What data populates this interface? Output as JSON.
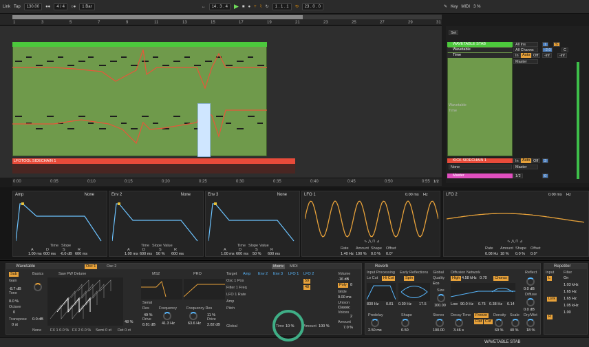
{
  "transport": {
    "link": "Link",
    "tap": "Tap",
    "tempo": "130.00",
    "signature": "4 / 4",
    "quantize": "1 Bar",
    "position": "14 . 3 . 4",
    "loop_start": "1 . 1 . 1",
    "loop_len": "23 . 0 . 0",
    "key": "Key",
    "midi": "MIDI",
    "cpu": "3 %"
  },
  "ruler": {
    "bars": [
      "1",
      "3",
      "5",
      "7",
      "9",
      "11",
      "13",
      "15",
      "17",
      "19",
      "21",
      "23",
      "25",
      "27",
      "29",
      "31"
    ]
  },
  "timeline": {
    "labels": [
      "0:00",
      "0:05",
      "0:10",
      "0:15",
      "0:20",
      "0:25",
      "0:30",
      "0:35",
      "0:40",
      "0:45",
      "0:50",
      "0:55"
    ],
    "zoom": "1/2"
  },
  "tracks": {
    "sidechain_clip": "LFOTOOL SIDECHAIN 1"
  },
  "mixer": {
    "set": "Set",
    "wavetable_track": "WAVETABLE STAB",
    "wavetable_device": "Wavetable",
    "time_param": "Time",
    "all_ins": "All Ins",
    "all_channels": "All Channs",
    "in": "In",
    "auto": "Auto",
    "off": "Off",
    "master": "Master",
    "value_neg2": "-2.0",
    "c": "C",
    "inf1": "-inf",
    "inf2": "-inf",
    "num1": "1",
    "num3": "3",
    "lane_wavetable": "Wavetable",
    "lane_time": "Time",
    "kick_track": "KICK SIDECHAIN 1",
    "none": "None",
    "master_track": "Master",
    "master_zoom": "1/2",
    "master_num": "0"
  },
  "mod_panels": {
    "amp": {
      "title": "Amp",
      "source": "None",
      "time": "Time",
      "slope": "Slope",
      "labels": [
        "A",
        "D",
        "S",
        "R"
      ],
      "values": [
        "1.00 ms",
        "600 ms",
        "-6.0 dB",
        "600 ms"
      ]
    },
    "env2": {
      "title": "Env 2",
      "source": "None",
      "time": "Time",
      "slope": "Slope",
      "value": "Value",
      "labels": [
        "A",
        "D",
        "S",
        "R"
      ],
      "values": [
        "1.00 ms",
        "600 ms",
        "50 %",
        "600 ms"
      ]
    },
    "env3": {
      "title": "Env 3",
      "source": "None",
      "time": "Time",
      "slope": "Slope",
      "value": "Value",
      "labels": [
        "A",
        "D",
        "S",
        "R"
      ],
      "values": [
        "1.00 ms",
        "600 ms",
        "50 %",
        "600 ms"
      ]
    },
    "lfo1": {
      "title": "LFO 1",
      "time": "0.00 ms",
      "hz": "Hz",
      "labels": [
        "Rate",
        "Amount",
        "Shape",
        "Offset"
      ],
      "values": [
        "1.40 Hz",
        "100 %",
        "0.0 %",
        "0.0°"
      ]
    },
    "lfo2": {
      "title": "LFO 2",
      "time": "0.00 ms",
      "hz": "Hz",
      "labels": [
        "Rate",
        "Amount",
        "Shape",
        "Offset"
      ],
      "values": [
        "0.08 Hz",
        "18 %",
        "0.0 %",
        "0.0°"
      ]
    }
  },
  "wavetable": {
    "title": "Wavetable",
    "osc1": "Osc 1",
    "osc2": "Osc 2",
    "sub": "Sub",
    "basics": "Basics",
    "preset": "Saw PW Detune",
    "gain": "Gain",
    "gain_val": "-8.7 dB",
    "tone": "Tone",
    "tone_val": "0.0 %",
    "octave": "Octave",
    "octave_val": "0",
    "transpose": "Transpose",
    "transpose_val": "0 st",
    "fx1": "FX 1  0.0 %",
    "fx2": "FX 2  0.0 %",
    "semi": "Semi  0 st",
    "det": "Det  0 ct",
    "pos": "48 %",
    "none": "None",
    "db0": "0.0 dB",
    "filter_type": "MS2",
    "pro": "PRO",
    "serial": "Serial",
    "res": "Res",
    "res_val": "49 %",
    "frequency": "Frequency",
    "frequency_val": "41.3 Hz",
    "frequency_res": "Frequency  Res",
    "freq2_val": "63.6 Hz",
    "res2_val": "11 %",
    "drive": "Drive",
    "drive_val": "8.81 dB",
    "drive2": "Drive",
    "drive2_val": "2.82 dB",
    "matrix": "Matrix",
    "midi": "MIDI",
    "target": "Target",
    "cols": [
      "Amp",
      "Env 2",
      "Env 3",
      "LFO 1",
      "LFO 2"
    ],
    "rows": [
      "Osc 1 Pos",
      "Filter 1 Freq",
      "LFO 1 Rate",
      "Amp",
      "Pitch"
    ],
    "cell1": "59",
    "cell2": "48",
    "global": "Global",
    "time": "Time",
    "time_val": "10 %",
    "amount": "Amount",
    "amount_val": "100 %",
    "volume": "Volume",
    "volume_val": "-16 dB",
    "poly": "Poly",
    "poly_val": "8",
    "glide": "Glide",
    "glide_val": "0.00 ms",
    "unison": "Unison",
    "classic": "Classic",
    "voices": "Voices",
    "voices_val": "2",
    "amount2": "Amount",
    "amount2_val": "7.0 %"
  },
  "reverb": {
    "title": "Reverb",
    "input_processing": "Input Processing",
    "lo_cut": "Lo Cut",
    "hi_cut": "Hi Cut",
    "hz830": "830 Hz",
    "q081": "0.81",
    "early": "Early Reflections",
    "spin": "Spin",
    "k030": "0.30 Hz",
    "v175": "17.5",
    "global": "Global",
    "quality": "Quality",
    "eco": "Eco",
    "size": "Size",
    "size_val": "100.00",
    "diffusion": "Diffusion Network",
    "high": "High",
    "k458": "4.58 kHz",
    "v070": "0.70",
    "chorus": "Chorus",
    "low": "Low",
    "k900": "90.0 Hz",
    "v075": "0.75",
    "k038": "0.38 Hz",
    "v014": "0.14",
    "reflect": "Reflect",
    "reflect_val": "0.0 dB",
    "diffuse": "Diffuse",
    "diffuse_val": "0.0 dB",
    "predelay": "Predelay",
    "predelay_val": "2.50 ms",
    "shape": "Shape",
    "shape_val": "0.50",
    "stereo": "Stereo",
    "stereo_val": "100.00",
    "decay": "Decay Time",
    "decay_val": "3.46 s",
    "freeze": "Freeze",
    "flat": "Flat",
    "cut": "Cut",
    "density": "Density",
    "density_val": "60 %",
    "scale": "Scale",
    "scale_val": "40 %",
    "drywet": "Dry/Wet",
    "drywet_val": "18 %"
  },
  "repetitor": {
    "title": "Repetitor",
    "input": "Input",
    "filter": "Filter",
    "on": "On",
    "l": "L",
    "r": "R",
    "link": "Link",
    "vals": [
      "1.03 kHz",
      "1.65 Hz",
      "1.65 Hz",
      "1.05 kHz",
      "1.00"
    ]
  },
  "status": {
    "track": "WAVETABLE STAB"
  }
}
